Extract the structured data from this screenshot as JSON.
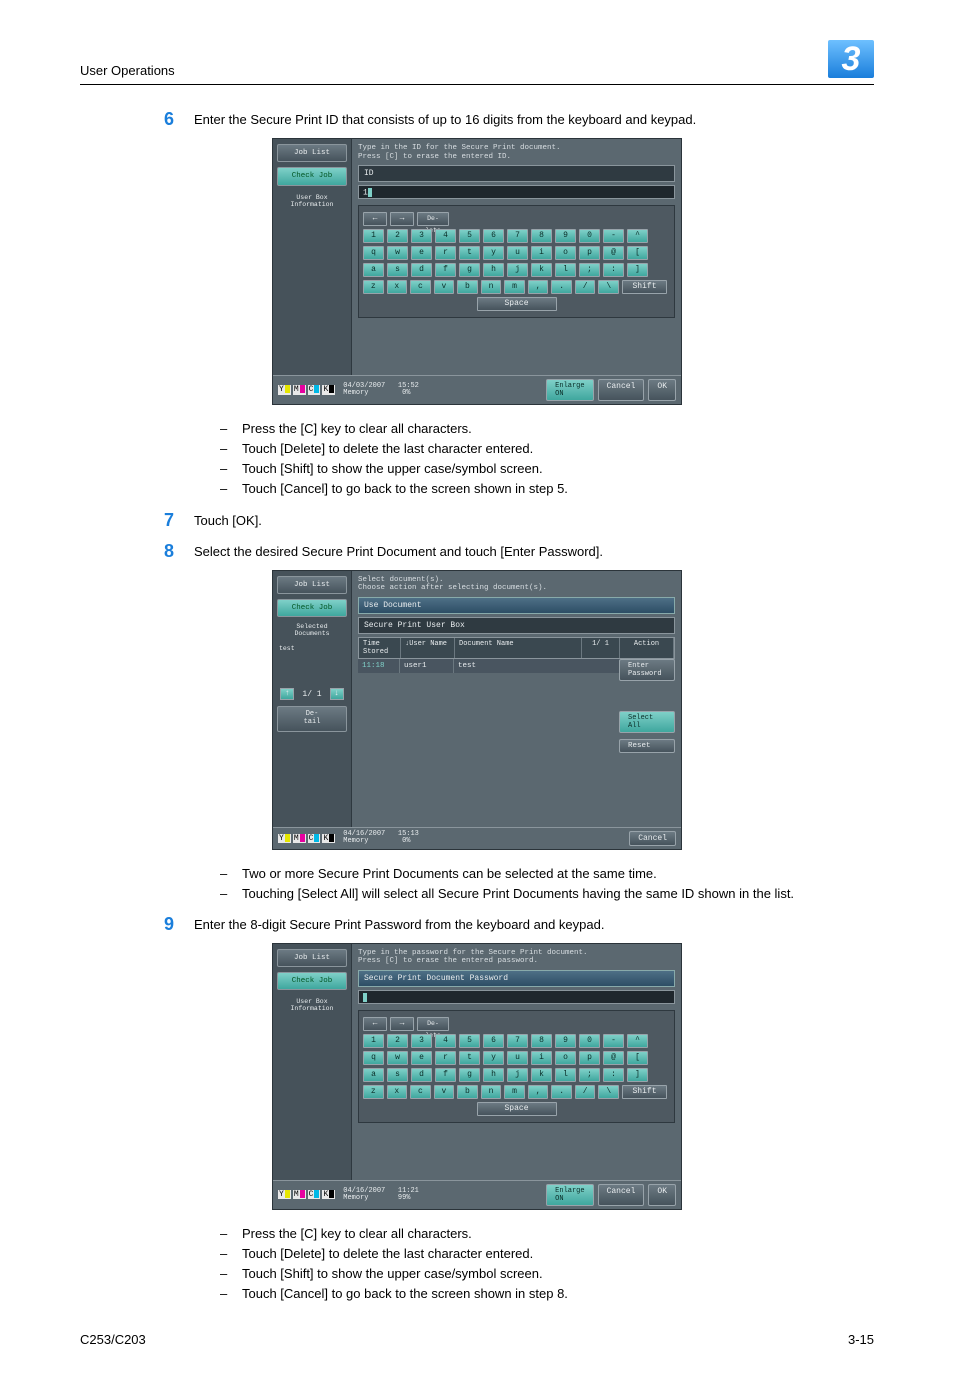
{
  "header": {
    "section": "User Operations",
    "chapter": "3"
  },
  "steps": {
    "s6": {
      "num": "6",
      "text": "Enter the Secure Print ID that consists of up to 16 digits from the keyboard and keypad.",
      "bullets": [
        "Press the [C] key to clear all characters.",
        "Touch [Delete] to delete the last character entered.",
        "Touch [Shift] to show the upper case/symbol screen.",
        "Touch [Cancel] to go back to the screen shown in step 5."
      ]
    },
    "s7": {
      "num": "7",
      "text": "Touch [OK]."
    },
    "s8": {
      "num": "8",
      "text": "Select the desired Secure Print Document and touch [Enter Password].",
      "bullets": [
        "Two or more Secure Print Documents can be selected at the same time.",
        "Touching [Select All] will select all Secure Print Documents having the same ID shown in the list."
      ]
    },
    "s9": {
      "num": "9",
      "text": "Enter the 8-digit Secure Print Password from the keyboard and keypad.",
      "bullets": [
        "Press the [C] key to clear all characters.",
        "Touch [Delete] to delete the last character entered.",
        "Touch [Shift] to show the upper case/symbol screen.",
        "Touch [Cancel] to go back to the screen shown in step 8."
      ]
    }
  },
  "panel_common": {
    "joblist": "Job List",
    "checkjob": "Check Job",
    "userbox": "User Box\nInformation",
    "ymck": {
      "y": "Y",
      "m": "M",
      "c": "C",
      "k": "K"
    },
    "enlarge": "Enlarge\nON",
    "cancel": "Cancel",
    "ok": "OK",
    "delete": "De-\nlete",
    "shift": "Shift",
    "space": "Space",
    "keys_row1": [
      "1",
      "2",
      "3",
      "4",
      "5",
      "6",
      "7",
      "8",
      "9",
      "0",
      "-",
      "^"
    ],
    "keys_row2": [
      "q",
      "w",
      "e",
      "r",
      "t",
      "y",
      "u",
      "i",
      "o",
      "p",
      "@",
      "["
    ],
    "keys_row3": [
      "a",
      "s",
      "d",
      "f",
      "g",
      "h",
      "j",
      "k",
      "l",
      ";",
      ":",
      "]"
    ],
    "keys_row4": [
      "z",
      "x",
      "c",
      "v",
      "b",
      "n",
      "m",
      ",",
      ".",
      "/",
      "\\"
    ]
  },
  "panel6": {
    "hint": "Type in the ID for the Secure Print document.\nPress [C] to erase the entered ID.",
    "id_label": "ID",
    "input": "1",
    "date": "04/03/2007",
    "time": "15:52",
    "mem_label": "Memory",
    "mem": "0%"
  },
  "panel8": {
    "hint": "Select document(s).\nChoose action after selecting document(s).",
    "tab_use": "Use Document",
    "tab_box": "Secure Print User Box",
    "sel_docs": "Selected Documents",
    "sel_item": "test",
    "cols": {
      "time": "Time\nStored",
      "user": "↓User Name",
      "doc": "Document Name",
      "action": "Action"
    },
    "row": {
      "time": "11:18",
      "user": "user1",
      "doc": "test"
    },
    "page_top": "1/   1",
    "enter_pw": "Enter\nPassword",
    "select_all": "Select\nAll",
    "reset": "Reset",
    "pager": {
      "label": "1/   1"
    },
    "detail": "De-\ntail",
    "date": "04/16/2007",
    "time": "15:13",
    "mem_label": "Memory",
    "mem": "0%",
    "cancel": "Cancel"
  },
  "panel9": {
    "hint": "Type in the password for the Secure Print document.\nPress [C] to erase the entered password.",
    "heading": "Secure Print Document Password",
    "date": "04/16/2007",
    "time": "11:21",
    "mem_label": "Memory",
    "mem": "99%"
  },
  "footer": {
    "left": "C253/C203",
    "right": "3-15"
  }
}
